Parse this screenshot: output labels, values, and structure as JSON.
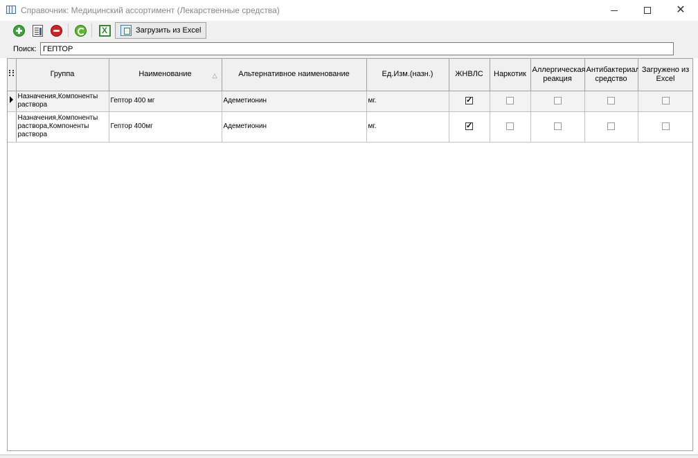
{
  "window": {
    "title": "Справочник: Медицинский ассортимент (Лекарственные средства)",
    "controls": {
      "minimize": "minimize-icon",
      "maximize": "maximize-icon",
      "close": "✕"
    }
  },
  "toolbar": {
    "buttons": [
      {
        "icon": "add-icon"
      },
      {
        "icon": "edit-icon"
      },
      {
        "icon": "delete-icon"
      },
      {
        "icon": "refresh-icon"
      },
      {
        "icon": "excel-icon",
        "glyph": "X"
      }
    ],
    "load_label": "Загрузить из Excel"
  },
  "search": {
    "label": "Поиск:",
    "value": "ГЕПТОР"
  },
  "grid": {
    "columns": [
      "Группа",
      "Наименование",
      "Альтернативное наименование",
      "Ед.Изм.(назн.)",
      "ЖНВЛС",
      "Наркотик",
      "Аллергическая реакция",
      "Антибактериальное средство",
      "Загружено из Excel"
    ],
    "sort_indicator": "△",
    "rows": [
      {
        "group": "Назначения,Компоненты раствора",
        "name": "Гептор 400 мг",
        "alt_name": "Адеметионин",
        "unit": "мг.",
        "zhnvls": true,
        "narcotic": false,
        "allergy": false,
        "antibacterial": false,
        "from_excel": false
      },
      {
        "group": "Назначения,Компоненты раствора,Компоненты раствора",
        "name": "Гептор 400мг",
        "alt_name": "Адеметионин",
        "unit": "мг.",
        "zhnvls": true,
        "narcotic": false,
        "allergy": false,
        "antibacterial": false,
        "from_excel": false
      }
    ]
  }
}
